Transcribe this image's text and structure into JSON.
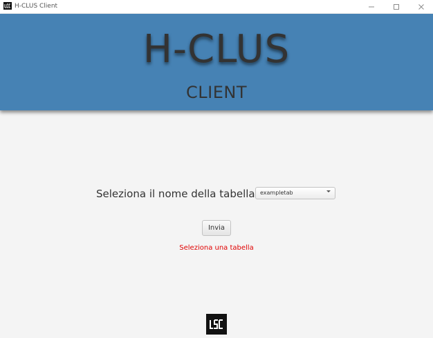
{
  "window": {
    "title": "H-CLUS Client",
    "icons": {
      "app": "app-logo-icon",
      "minimize": "minimize-icon",
      "maximize": "maximize-icon",
      "close": "close-icon"
    }
  },
  "banner": {
    "title": "H-CLUS",
    "subtitle": "CLIENT",
    "background_color": "#4682b4"
  },
  "form": {
    "select_label": "Seleziona il nome della tabella",
    "table_select": {
      "value": "exampletab",
      "icon": "chevron-down-icon"
    },
    "submit_label": "Invia",
    "error_message": "Seleziona una tabella",
    "error_color": "#e00000"
  },
  "footer": {
    "logo_icon": "footer-logo-icon"
  }
}
